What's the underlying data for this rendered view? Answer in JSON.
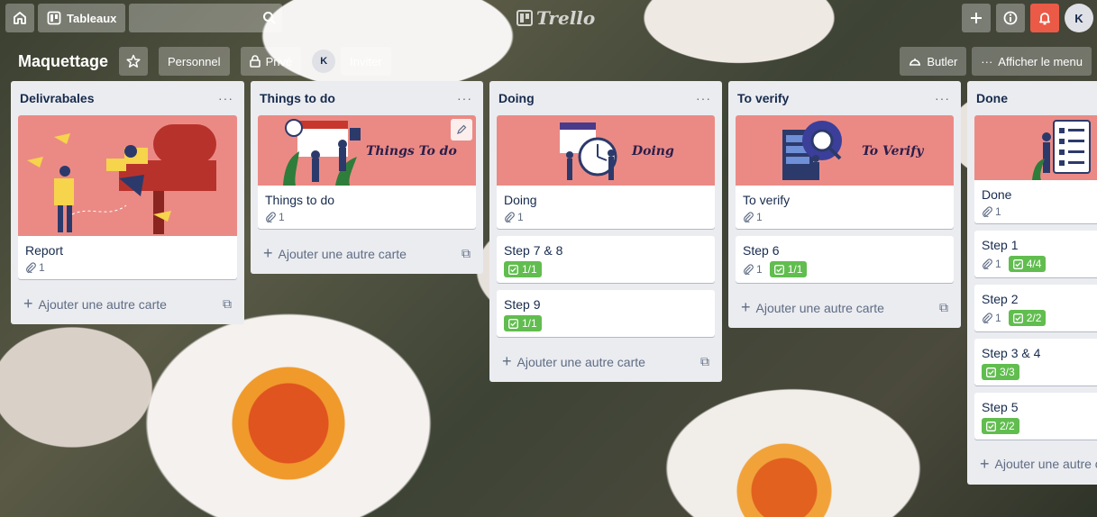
{
  "header": {
    "boards_label": "Tableaux",
    "search_value": "",
    "logo_text": "Trello",
    "avatar_initial": "K"
  },
  "board": {
    "title": "Maquettage",
    "visibility_team": "Personnel",
    "visibility_private": "Privé",
    "member_initial": "K",
    "invite_label": "Inviter",
    "butler_label": "Butler",
    "menu_label": "Afficher le menu"
  },
  "lists": [
    {
      "title": "Delivrabales",
      "cards": [
        {
          "title": "Report",
          "attachments": "1"
        }
      ],
      "add_label": "Ajouter une autre carte"
    },
    {
      "title": "Things to do",
      "cover_text": "Things To do",
      "cards": [
        {
          "title": "Things to do",
          "attachments": "1"
        }
      ],
      "add_label": "Ajouter une autre carte"
    },
    {
      "title": "Doing",
      "cover_text": "Doing",
      "cards": [
        {
          "title": "Doing",
          "attachments": "1"
        },
        {
          "title": "Step 7 & 8",
          "checklist": "1/1"
        },
        {
          "title": "Step 9",
          "checklist": "1/1"
        }
      ],
      "add_label": "Ajouter une autre carte"
    },
    {
      "title": "To verify",
      "cover_text": "To Verify",
      "cards": [
        {
          "title": "To verify",
          "attachments": "1"
        },
        {
          "title": "Step 6",
          "attachments": "1",
          "checklist": "1/1"
        }
      ],
      "add_label": "Ajouter une autre carte"
    },
    {
      "title": "Done",
      "cards": [
        {
          "title": "Done",
          "attachments": "1"
        },
        {
          "title": "Step 1",
          "attachments": "1",
          "checklist": "4/4"
        },
        {
          "title": "Step 2",
          "attachments": "1",
          "checklist": "2/2"
        },
        {
          "title": "Step 3 & 4",
          "checklist": "3/3"
        },
        {
          "title": "Step 5",
          "checklist": "2/2"
        }
      ],
      "add_label": "Ajouter une autre c"
    }
  ],
  "colors": {
    "cover": "#eb8a85",
    "checklist_done": "#61bd4f",
    "notification": "#eb5a46",
    "list_bg": "#ebecf0"
  }
}
